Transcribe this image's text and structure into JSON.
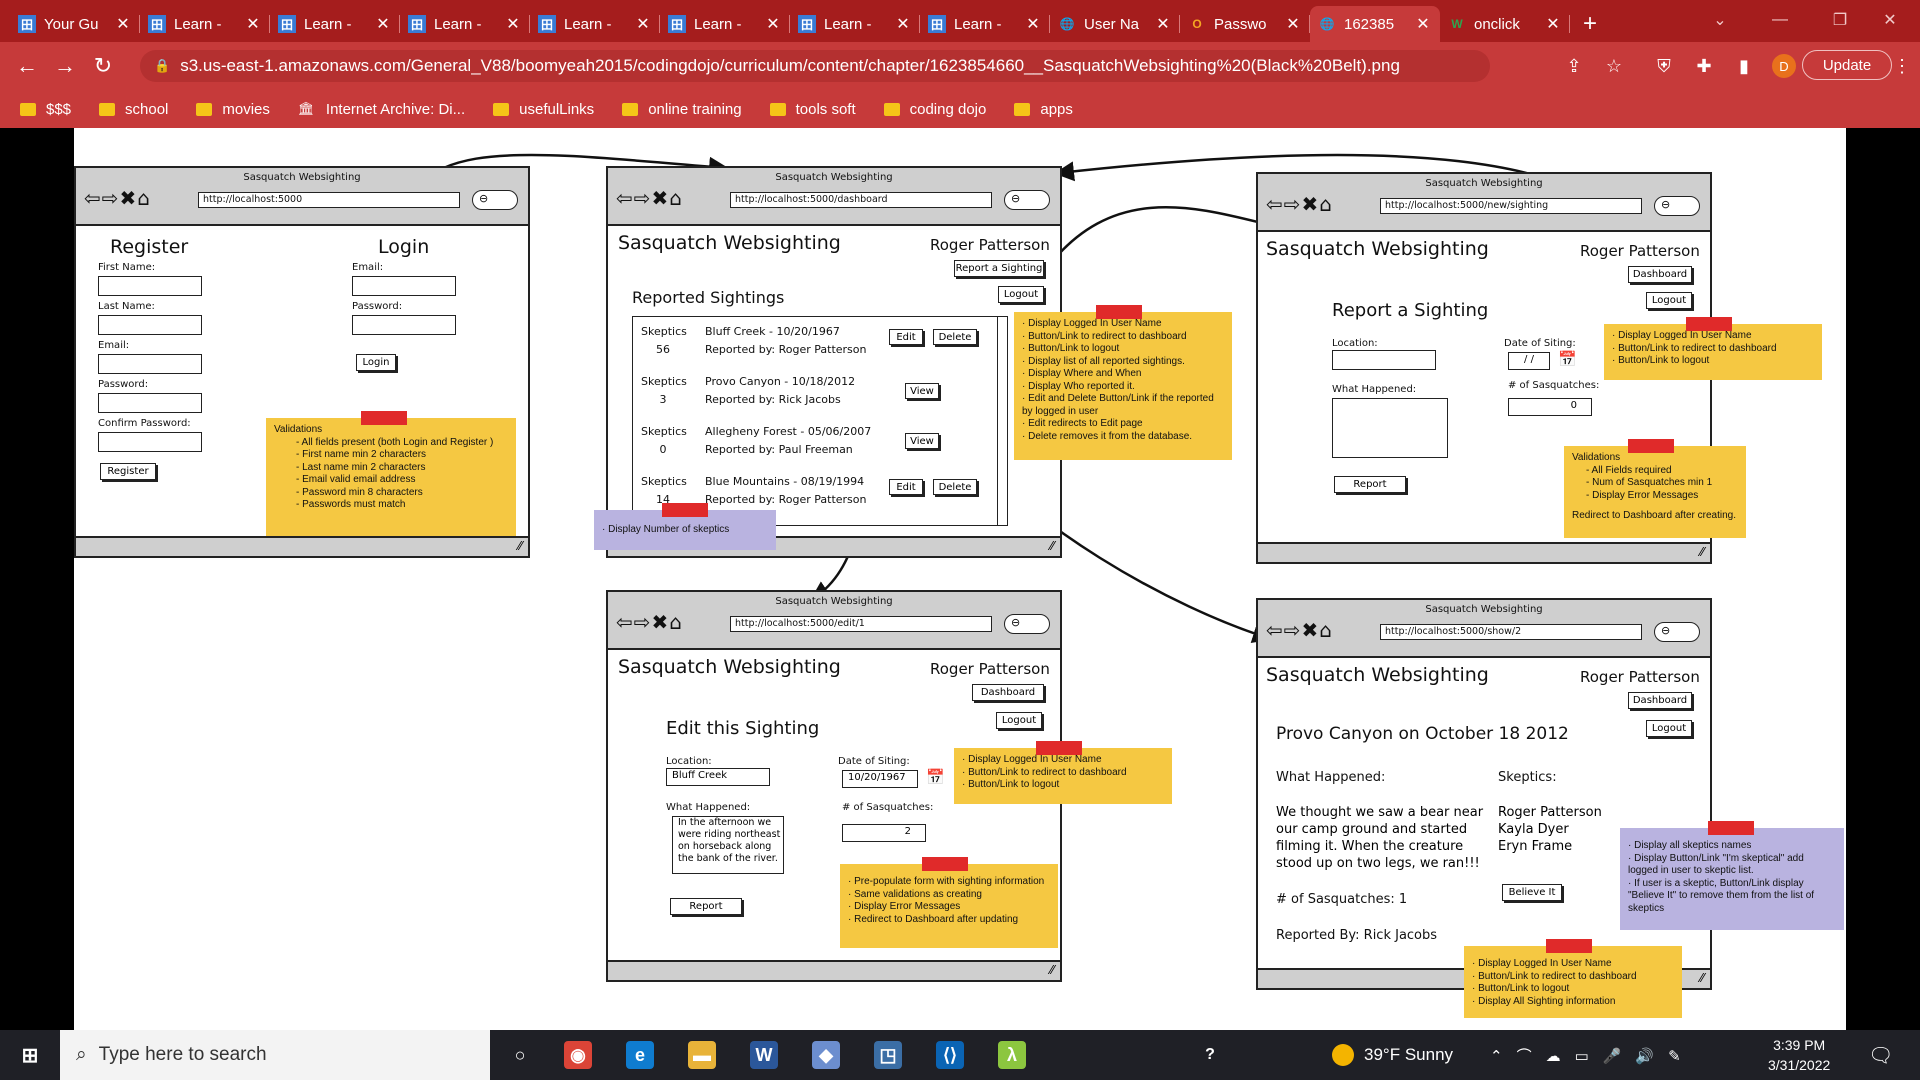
{
  "browser": {
    "tabs": [
      {
        "title": "Your Gu",
        "icon": "coding-dojo-icon"
      },
      {
        "title": "Learn -",
        "icon": "coding-dojo-icon"
      },
      {
        "title": "Learn -",
        "icon": "coding-dojo-icon"
      },
      {
        "title": "Learn -",
        "icon": "coding-dojo-icon"
      },
      {
        "title": "Learn -",
        "icon": "coding-dojo-icon"
      },
      {
        "title": "Learn -",
        "icon": "coding-dojo-icon"
      },
      {
        "title": "Learn -",
        "icon": "coding-dojo-icon"
      },
      {
        "title": "Learn -",
        "icon": "coding-dojo-icon"
      },
      {
        "title": "User Na",
        "icon": "globe-icon"
      },
      {
        "title": "Passwo",
        "icon": "opera-icon"
      },
      {
        "title": "162385",
        "icon": "globe-icon",
        "active": true
      },
      {
        "title": "onclick",
        "icon": "w3schools-icon"
      }
    ],
    "url": "s3.us-east-1.amazonaws.com/General_V88/boomyeah2015/codingdojo/curriculum/content/chapter/1623854660__SasquatchWebsighting%20(Black%20Belt).png",
    "update_label": "Update",
    "profile_initial": "D",
    "bookmarks": [
      "$$$",
      "school",
      "movies",
      "Internet Archive: Di...",
      "usefulLinks",
      "online training",
      "tools soft",
      "coding dojo",
      "apps"
    ],
    "colors": {
      "accent": "#c63a3a",
      "tab_strip": "#a51d1d"
    }
  },
  "wireframe": {
    "window_title": "Sasquatch Websighting",
    "login_page": {
      "url": "http://localhost:5000",
      "register_title": "Register",
      "login_title": "Login",
      "first_name": "First Name:",
      "last_name": "Last Name:",
      "email": "Email:",
      "password": "Password:",
      "confirm_password": "Confirm Password:",
      "register_btn": "Register",
      "login_email": "Email:",
      "login_password": "Password:",
      "login_btn": "Login",
      "note_title": "Validations",
      "note_items": [
        "- All fields present (both Login and Register )",
        "- First name min 2 characters",
        "- Last name min 2 characters",
        "- Email valid email address",
        "- Password min 8 characters",
        "- Passwords must match"
      ]
    },
    "dashboard_page": {
      "url": "http://localhost:5000/dashboard",
      "title": "Sasquatch Websighting",
      "user": "Roger Patterson",
      "report_btn": "Report a Sighting",
      "logout_btn": "Logout",
      "section": "Reported Sightings",
      "skeptics_label": "Skeptics",
      "rows": [
        {
          "count": "56",
          "place": "Bluff Creek - 10/20/1967",
          "by": "Reported by: Roger Patterson",
          "actions": [
            "Edit",
            "Delete"
          ]
        },
        {
          "count": "3",
          "place": "Provo Canyon - 10/18/2012",
          "by": "Reported by: Rick Jacobs",
          "actions": [
            "View"
          ]
        },
        {
          "count": "0",
          "place": "Allegheny Forest - 05/06/2007",
          "by": "Reported by: Paul Freeman",
          "actions": [
            "View"
          ]
        },
        {
          "count": "14",
          "place": "Blue Mountains - 08/19/1994",
          "by": "Reported by: Roger Patterson",
          "actions": [
            "Edit",
            "Delete"
          ]
        }
      ],
      "note_items": [
        "Display Logged In User Name",
        "Button/Link to redirect to dashboard",
        "Button/Link to logout",
        "Display list of all reported sightings.",
        "Display Where and When",
        "Display Who reported it.",
        "Edit and Delete Button/Link if the reported by logged in user",
        "Edit redirects to Edit page",
        "Delete removes it from the database."
      ],
      "purple_note": "Display Number of skeptics"
    },
    "new_page": {
      "url": "http://localhost:5000/new/sighting",
      "title": "Sasquatch Websighting",
      "user": "Roger Patterson",
      "dashboard_btn": "Dashboard",
      "logout_btn": "Logout",
      "form_title": "Report a Sighting",
      "location": "Location:",
      "date": "Date of Siting:",
      "date_value": "/ /",
      "what": "What Happened:",
      "num": "# of Sasquatches:",
      "num_value": "0",
      "report_btn": "Report",
      "note1_items": [
        "Display Logged In User Name",
        "Button/Link to redirect to dashboard",
        "Button/Link to logout"
      ],
      "note2_title": "Validations",
      "note2_items": [
        "- All Fields required",
        "- Num of Sasquatches min 1",
        "- Display Error Messages"
      ],
      "note2_footer": "Redirect to Dashboard after creating."
    },
    "edit_page": {
      "url": "http://localhost:5000/edit/1",
      "title": "Sasquatch Websighting",
      "user": "Roger Patterson",
      "dashboard_btn": "Dashboard",
      "logout_btn": "Logout",
      "form_title": "Edit this Sighting",
      "location": "Location:",
      "location_value": "Bluff Creek",
      "date": "Date of Siting:",
      "date_value": "10/20/1967",
      "what": "What Happened:",
      "what_value": "In the afternoon we were riding northeast on horseback along the bank of the river.",
      "num": "# of Sasquatches:",
      "num_value": "2",
      "report_btn": "Report",
      "note1_items": [
        "Display Logged In User Name",
        "Button/Link to redirect to dashboard",
        "Button/Link to logout"
      ],
      "note2_items": [
        "Pre-populate form with sighting information",
        "Same validations as creating",
        "Display Error Messages",
        "Redirect to Dashboard after updating"
      ]
    },
    "show_page": {
      "url": "http://localhost:5000/show/2",
      "title": "Sasquatch Websighting",
      "user": "Roger Patterson",
      "dashboard_btn": "Dashboard",
      "logout_btn": "Logout",
      "heading": "Provo Canyon on October 18 2012",
      "what": "What Happened:",
      "story": [
        "We thought we saw a bear near",
        "our camp ground and started",
        "filming it.  When the creature",
        "stood up on two legs, we ran!!!"
      ],
      "num": "# of Sasquatches: 1",
      "reported": "Reported By: Rick Jacobs",
      "skeptics_title": "Skeptics:",
      "skeptics": [
        "Roger Patterson",
        "Kayla Dyer",
        "Eryn Frame"
      ],
      "believe_btn": "Believe It",
      "purple_items": [
        "Display all skeptics names",
        "Display Button/Link \"I'm skeptical\" add logged in user to skeptic list.",
        "If user is a skeptic, Button/Link display \"Believe It\" to remove them from the list of skeptics"
      ],
      "note_items": [
        "Display Logged In User Name",
        "Button/Link to redirect to dashboard",
        "Button/Link to logout",
        "Display All Sighting information"
      ]
    }
  },
  "taskbar": {
    "search_placeholder": "Type here to search",
    "weather": "39°F  Sunny",
    "time": "3:39 PM",
    "date": "3/31/2022",
    "apps": [
      "cortana-icon",
      "chrome-icon",
      "edge-icon",
      "file-explorer-icon",
      "word-icon",
      "devtools-icon",
      "app-icon",
      "vscode-icon",
      "lambda-icon"
    ]
  }
}
